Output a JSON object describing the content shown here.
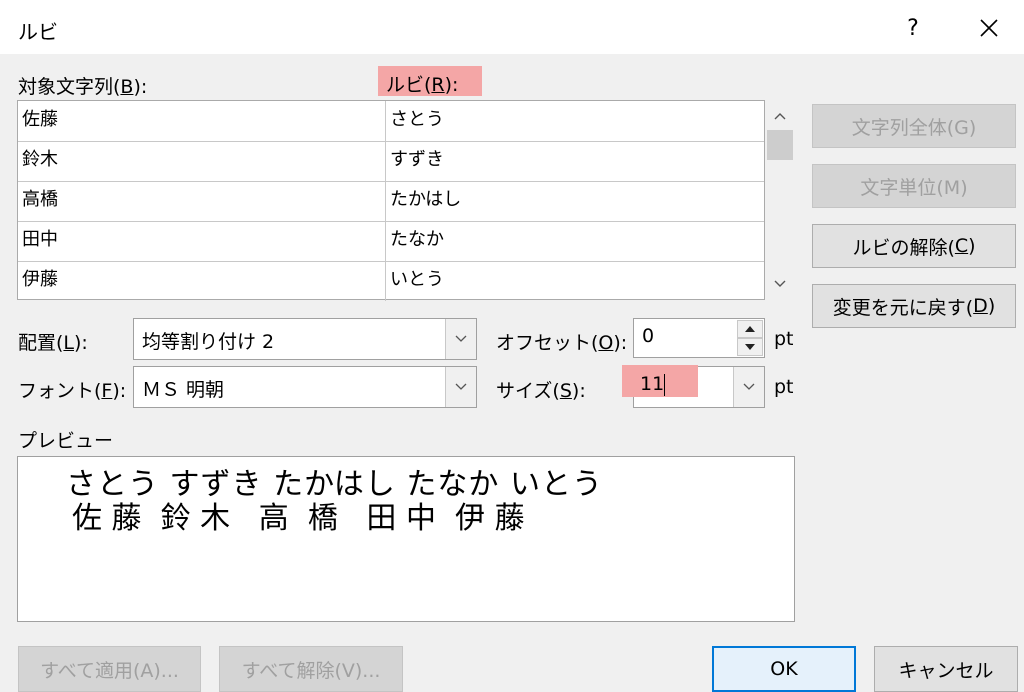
{
  "dialog": {
    "title": "ルビ",
    "help": "?"
  },
  "target_label": {
    "pre": "対象文字列(",
    "key": "B",
    "post": "):"
  },
  "ruby_label": {
    "pre": "ルビ(",
    "key": "R",
    "post": "):"
  },
  "rows": [
    {
      "base": "佐藤",
      "ruby": "さとう"
    },
    {
      "base": "鈴木",
      "ruby": "すずき"
    },
    {
      "base": "高橋",
      "ruby": "たかはし"
    },
    {
      "base": "田中",
      "ruby": "たなか"
    },
    {
      "base": "伊藤",
      "ruby": "いとう"
    }
  ],
  "side_buttons": {
    "whole": "文字列全体(G)",
    "unit": "文字単位(M)",
    "remove": {
      "pre": "ルビの解除(",
      "key": "C",
      "post": ")"
    },
    "restore": {
      "pre": "変更を元に戻す(",
      "key": "D",
      "post": ")"
    }
  },
  "alignment": {
    "label_pre": "配置(",
    "key": "L",
    "label_post": "):",
    "value": "均等割り付け 2"
  },
  "offset": {
    "label_pre": "オフセット(",
    "key": "O",
    "label_post": "):",
    "value": "0",
    "unit": "pt"
  },
  "font": {
    "label_pre": "フォント(",
    "key": "F",
    "label_post": "):",
    "value": "ＭＳ 明朝"
  },
  "size": {
    "label_pre": "サイズ(",
    "key": "S",
    "label_post": "):",
    "value": "11",
    "unit": "pt"
  },
  "preview": {
    "label": "プレビュー",
    "ruby_line": "さとう すずき たかはし たなか いとう",
    "base_line": "佐 藤  鈴 木   高  橋   田 中  伊 藤"
  },
  "footer": {
    "apply_all": "すべて適用(A)...",
    "clear_all": "すべて解除(V)...",
    "ok": "OK",
    "cancel": "キャンセル"
  },
  "highlight_color": "#f4a6a6"
}
